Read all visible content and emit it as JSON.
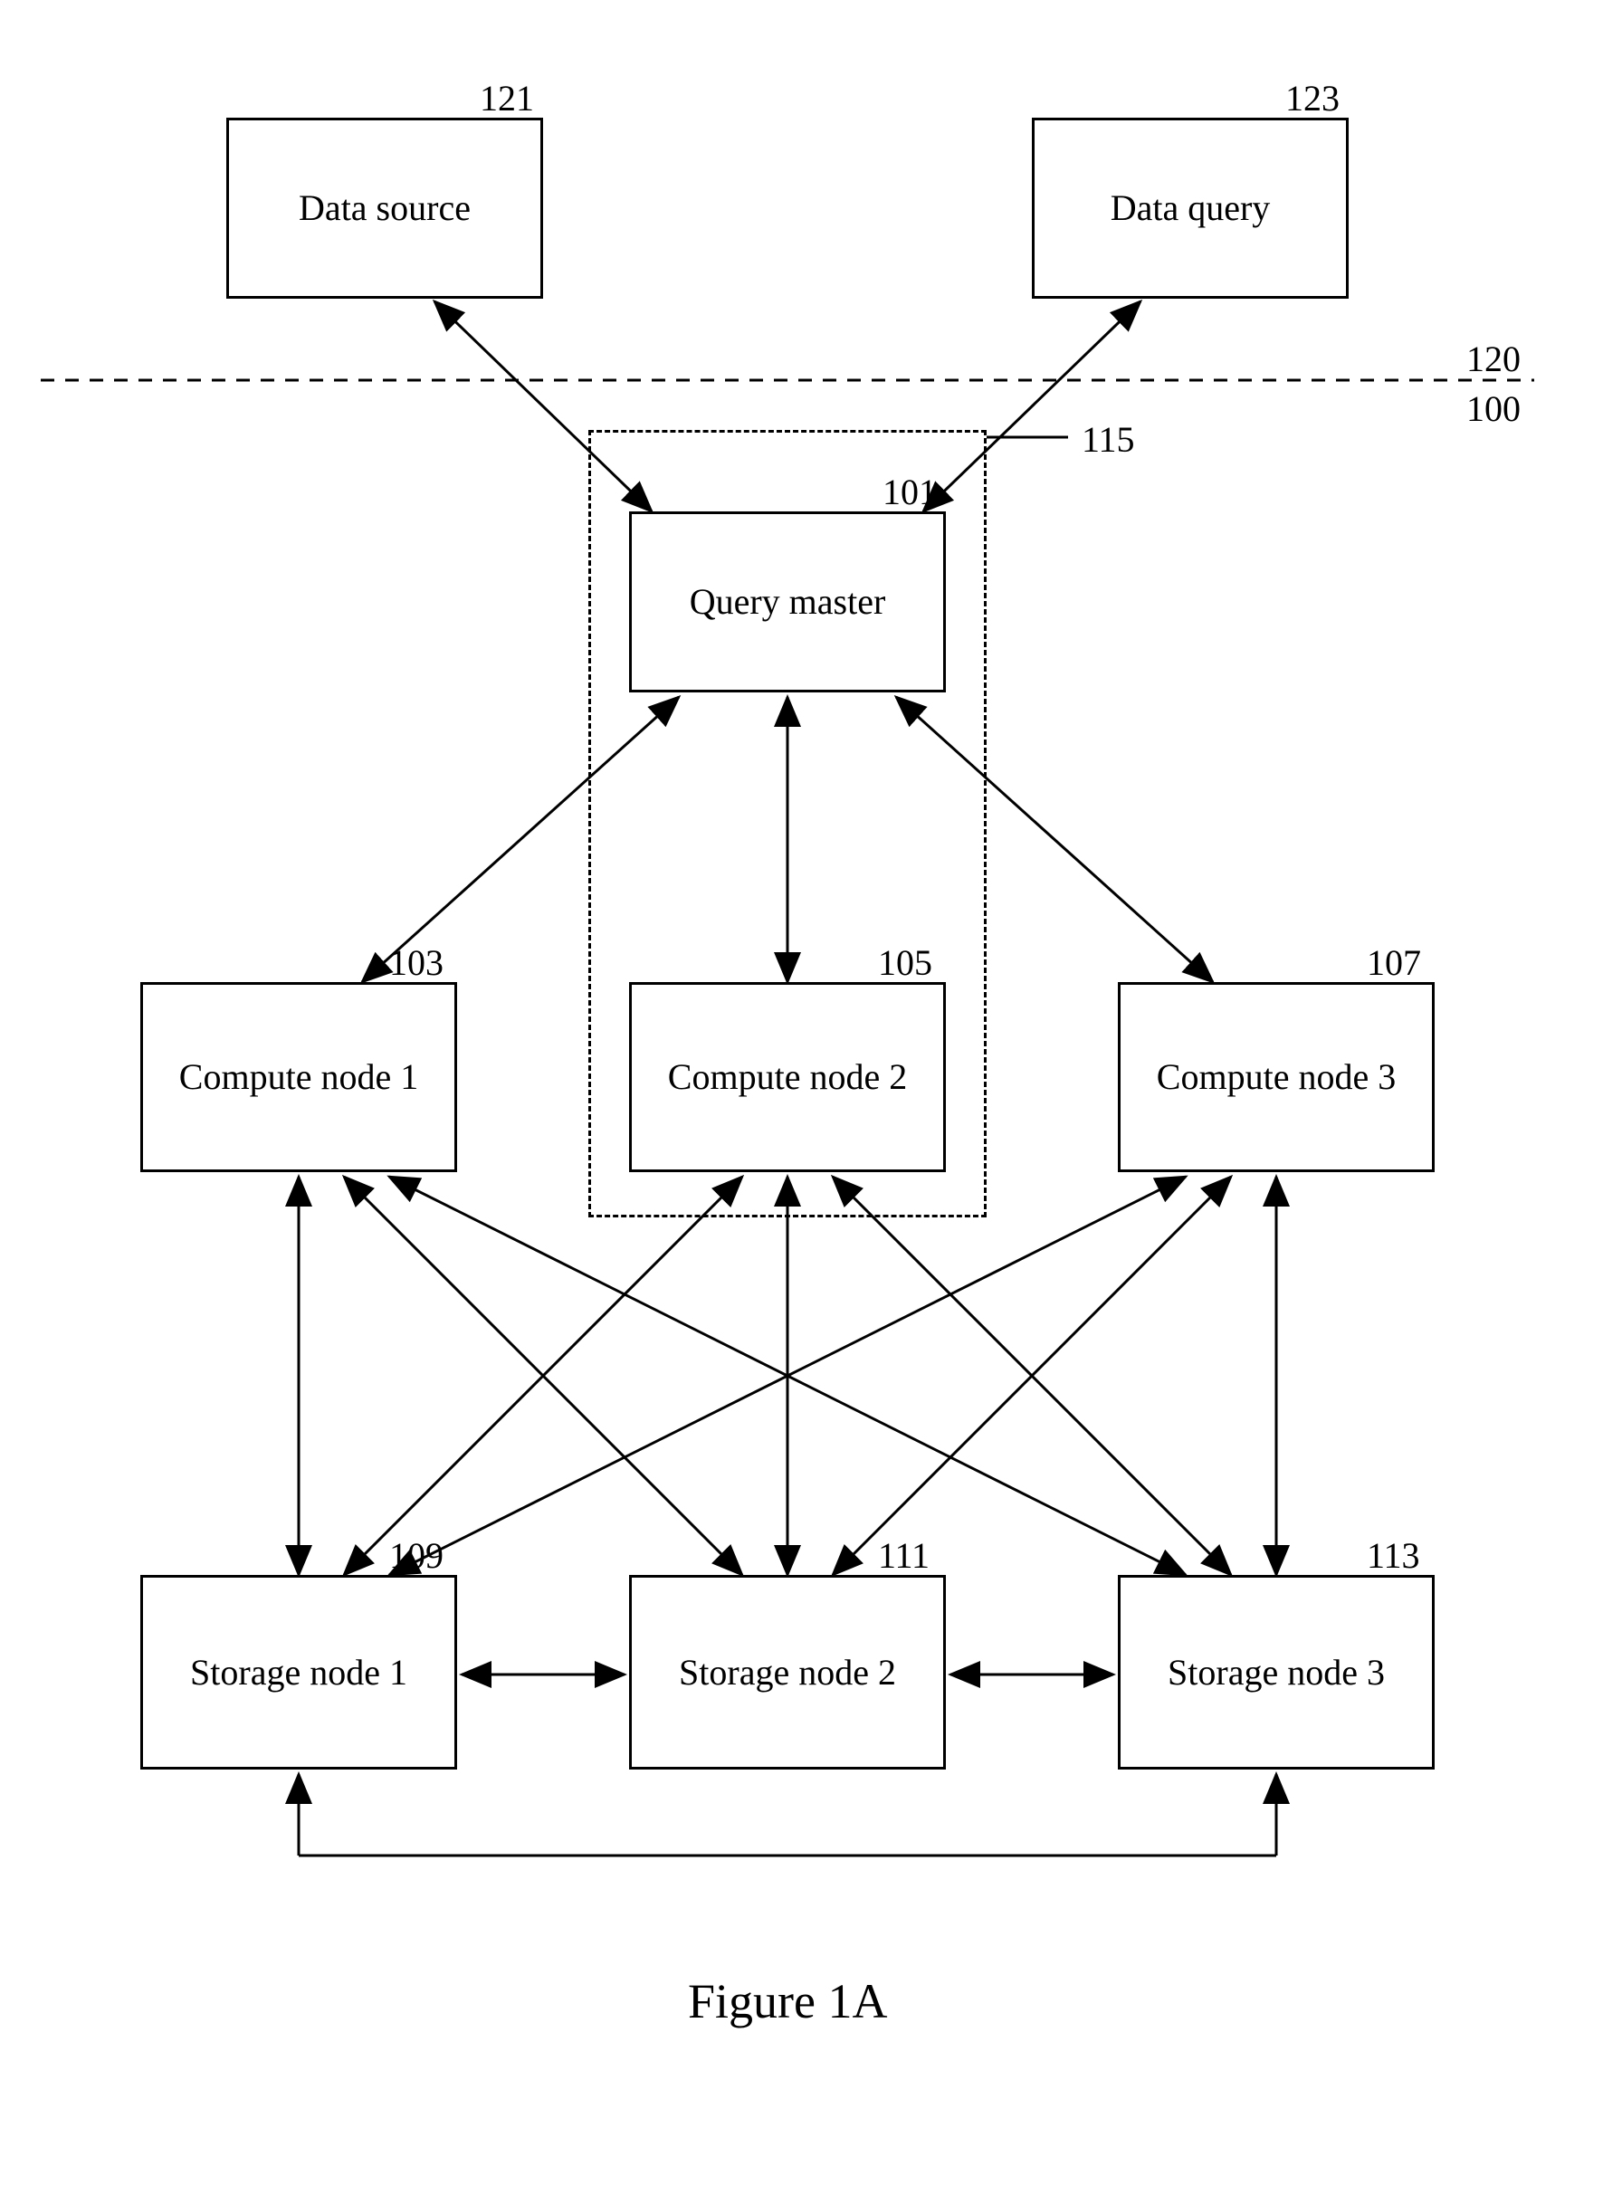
{
  "labels": {
    "n121": "121",
    "n123": "123",
    "n120": "120",
    "n100": "100",
    "n115": "115",
    "n101": "101",
    "n103": "103",
    "n105": "105",
    "n107": "107",
    "n109": "109",
    "n111": "111",
    "n113": "113"
  },
  "boxes": {
    "dataSource": "Data source",
    "dataQuery": "Data query",
    "queryMaster": "Query master",
    "compute1": "Compute node 1",
    "compute2": "Compute node 2",
    "compute3": "Compute node 3",
    "storage1": "Storage node 1",
    "storage2": "Storage node 2",
    "storage3": "Storage node 3"
  },
  "caption": "Figure 1A"
}
